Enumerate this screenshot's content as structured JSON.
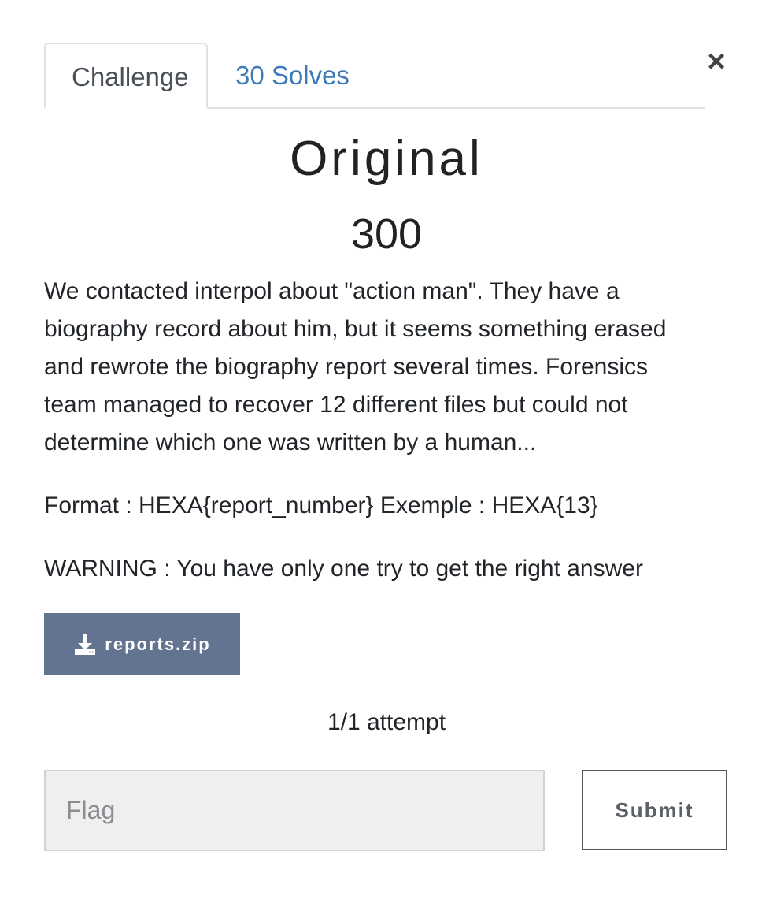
{
  "tabs": {
    "challenge": "Challenge",
    "solves": "30 Solves"
  },
  "close_label": "×",
  "challenge": {
    "name": "Original",
    "value": "300",
    "description": [
      "We contacted interpol about \"action man\". They have a biography record about him, but it seems something erased and rewrote the biography report several times. Forensics team managed to recover 12 different files but could not determine which one was written by a human...",
      "Format : HEXA{report_number} Exemple : HEXA{13}",
      "WARNING : You have only one try to get the right answer"
    ],
    "file": {
      "label": "reports.zip",
      "icon": "download-icon"
    },
    "attempts": "1/1 attempt"
  },
  "form": {
    "flag_placeholder": "Flag",
    "submit_label": "Submit"
  },
  "colors": {
    "tab_link": "#3d7ab8",
    "download_button": "#62748f"
  }
}
